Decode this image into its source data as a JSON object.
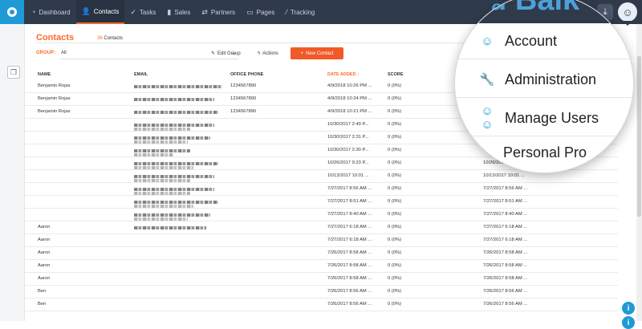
{
  "nav": {
    "items": [
      {
        "label": "Dashboard",
        "icon": "dashboard-icon",
        "glyph": "◔"
      },
      {
        "label": "Contacts",
        "icon": "person-icon",
        "glyph": "👤"
      },
      {
        "label": "Tasks",
        "icon": "check-icon",
        "glyph": "✓"
      },
      {
        "label": "Sales",
        "icon": "bar-chart-icon",
        "glyph": "▮"
      },
      {
        "label": "Partners",
        "icon": "handshake-icon",
        "glyph": "⇄"
      },
      {
        "label": "Pages",
        "icon": "page-icon",
        "glyph": "▭"
      },
      {
        "label": "Tracking",
        "icon": "tracking-icon",
        "glyph": "⁄"
      }
    ],
    "active": "Contacts",
    "brand_fragment": "ed Balk"
  },
  "header": {
    "title": "Contacts",
    "count_number": "36",
    "count_label": "Contacts"
  },
  "toolbar": {
    "group_label": "GROUP:",
    "group_value": "All",
    "edit_group": "Edit Group",
    "actions": "Actions",
    "new_contact": "New Contact"
  },
  "table": {
    "headers": {
      "name": "NAME",
      "email": "EMAIL",
      "phone": "OFFICE PHONE",
      "date": "DATE ADDED",
      "score": "SCORE"
    },
    "sort_arrow": "↓",
    "rows": [
      {
        "name": "Benjamin Rojas",
        "phone": "1234567890",
        "date": "4/9/2018 10:26 PM ...",
        "score": "0 (0%)",
        "date2": ""
      },
      {
        "name": "Benjamin Rojas",
        "phone": "1234567890",
        "date": "4/9/2018 10:24 PM ...",
        "score": "0 (0%)",
        "date2": ""
      },
      {
        "name": "Benjamin Rojas",
        "phone": "1234567890",
        "date": "4/9/2018 10:21 PM ...",
        "score": "0 (0%)",
        "date2": ""
      },
      {
        "name": "",
        "phone": "",
        "date": "10/30/2017 2:49 P...",
        "score": "0 (0%)",
        "date2": ""
      },
      {
        "name": "",
        "phone": "",
        "date": "10/30/2017 2:31 P...",
        "score": "0 (0%)",
        "date2": ""
      },
      {
        "name": "",
        "phone": "",
        "date": "10/30/2017 2:30 P...",
        "score": "0 (0%)",
        "date2": ""
      },
      {
        "name": "",
        "phone": "",
        "date": "10/26/2017 9:23 P...",
        "score": "0 (0%)",
        "date2": "10/26/2017 9:23 P..."
      },
      {
        "name": "",
        "phone": "",
        "date": "10/13/2017 10:01 ...",
        "score": "0 (0%)",
        "date2": "10/13/2017 10:01 ..."
      },
      {
        "name": "",
        "phone": "",
        "date": "7/27/2017 8:56 AM ...",
        "score": "0 (0%)",
        "date2": "7/27/2017 8:56 AM ..."
      },
      {
        "name": "",
        "phone": "",
        "date": "7/27/2017 8:51 AM ...",
        "score": "0 (0%)",
        "date2": "7/27/2017 8:51 AM ..."
      },
      {
        "name": "",
        "phone": "",
        "date": "7/27/2017 8:40 AM ...",
        "score": "0 (0%)",
        "date2": "7/27/2017 8:40 AM ..."
      },
      {
        "name": "Aaron",
        "phone": "",
        "date": "7/27/2017 6:18 AM ...",
        "score": "0 (0%)",
        "date2": "7/27/2017 6:18 AM ..."
      },
      {
        "name": "Aaron",
        "phone": "",
        "date": "7/27/2017 6:18 AM ...",
        "score": "0 (0%)",
        "date2": "7/27/2017 6:18 AM ..."
      },
      {
        "name": "Aaron",
        "phone": "",
        "date": "7/26/2017 8:58 AM ...",
        "score": "0 (0%)",
        "date2": "7/26/2017 8:58 AM ..."
      },
      {
        "name": "Aaron",
        "phone": "",
        "date": "7/26/2017 8:58 AM ...",
        "score": "0 (0%)",
        "date2": "7/26/2017 8:58 AM ..."
      },
      {
        "name": "Aaron",
        "phone": "",
        "date": "7/26/2017 8:58 AM ...",
        "score": "0 (0%)",
        "date2": "7/26/2017 8:58 AM ..."
      },
      {
        "name": "Ben",
        "phone": "",
        "date": "7/26/2017 8:56 AM ...",
        "score": "0 (0%)",
        "date2": "7/26/2017 8:56 AM ..."
      },
      {
        "name": "Ben",
        "phone": "",
        "date": "7/26/2017 8:56 AM ...",
        "score": "0 (0%)",
        "date2": "7/26/2017 8:56 AM ..."
      }
    ]
  },
  "user_menu": {
    "items": [
      {
        "label": "Account",
        "icon": "person-icon"
      },
      {
        "label": "Administration",
        "icon": "wrench-icon"
      },
      {
        "label": "Manage Users",
        "icon": "users-icon"
      },
      {
        "label": "Personal Pro",
        "icon": ""
      }
    ]
  },
  "colors": {
    "accent": "#ff6a2a",
    "nav_bg": "#2f3a4b",
    "brand_blue": "#1f9ad6"
  }
}
